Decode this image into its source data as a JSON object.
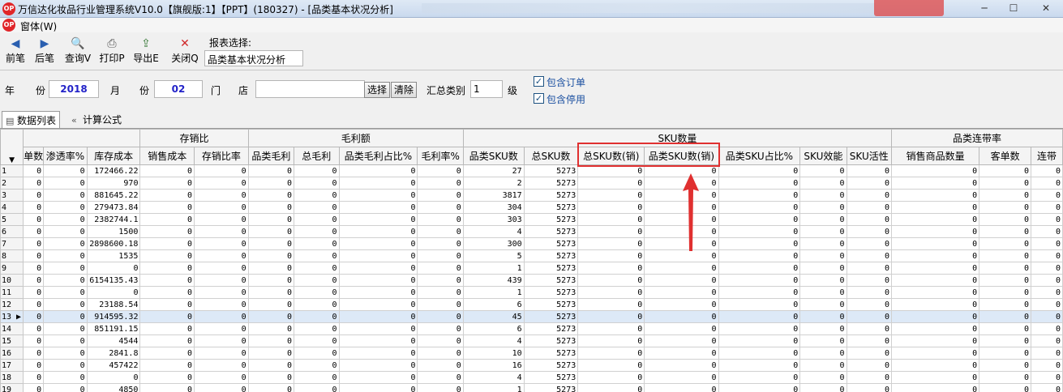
{
  "window": {
    "title": "万信达化妆品行业管理系统V10.0【旗舰版:1】【PPT】(180327) - [品类基本状况分析]",
    "app_icon_text": "OP",
    "controls": {
      "minimize": "─",
      "maximize": "☐",
      "close": "✕"
    }
  },
  "menu": {
    "window_label": "窗体(W)"
  },
  "toolbar": {
    "prev": "前笔",
    "next": "后笔",
    "query": "查询V",
    "print": "打印P",
    "export": "导出E",
    "close": "关闭Q",
    "report_label": "报表选择:",
    "report_value": "品类基本状况分析"
  },
  "filters": {
    "year_label_1": "年",
    "year_label_2": "份",
    "year_value": "2018",
    "month_label_1": "月",
    "month_label_2": "份",
    "month_value": "02",
    "store_label_1": "门",
    "store_label_2": "店",
    "store_value": "",
    "select_btn": "选择",
    "clear_btn": "清除",
    "summary_label": "汇总类别",
    "summary_value": "1",
    "level_label": "级",
    "include_orders": "包含订单",
    "include_disabled": "包含停用"
  },
  "tabs": {
    "data_list": "数据列表",
    "formula": "计算公式"
  },
  "grid": {
    "groups": {
      "g1": "存销比",
      "g2": "毛利额",
      "g3": "SKU数量",
      "g4": "品类连带率"
    },
    "columns": [
      "单数",
      "渗透率%",
      "库存成本",
      "销售成本",
      "存销比率",
      "品类毛利",
      "总毛利",
      "品类毛利占比%",
      "毛利率%",
      "品类SKU数",
      "总SKU数",
      "总SKU数(销)",
      "品类SKU数(销)",
      "品类SKU占比%",
      "SKU效能",
      "SKU活性",
      "销售商品数量",
      "客单数",
      "连带"
    ],
    "rows": [
      {
        "n": "1",
        "inv": "172466.22",
        "sku": "27",
        "total": "5273"
      },
      {
        "n": "2",
        "inv": "970",
        "sku": "2",
        "total": "5273"
      },
      {
        "n": "3",
        "inv": "881645.22",
        "sku": "3817",
        "total": "5273"
      },
      {
        "n": "4",
        "inv": "279473.84",
        "sku": "304",
        "total": "5273"
      },
      {
        "n": "5",
        "inv": "2382744.1",
        "sku": "303",
        "total": "5273"
      },
      {
        "n": "6",
        "inv": "1500",
        "sku": "4",
        "total": "5273"
      },
      {
        "n": "7",
        "inv": "2898600.18",
        "sku": "300",
        "total": "5273"
      },
      {
        "n": "8",
        "inv": "1535",
        "sku": "5",
        "total": "5273"
      },
      {
        "n": "9",
        "inv": "0",
        "sku": "1",
        "total": "5273"
      },
      {
        "n": "10",
        "inv": "6154135.43",
        "sku": "439",
        "total": "5273"
      },
      {
        "n": "11",
        "inv": "0",
        "sku": "1",
        "total": "5273"
      },
      {
        "n": "12",
        "inv": "23188.54",
        "sku": "6",
        "total": "5273"
      },
      {
        "n": "13",
        "inv": "914595.32",
        "sku": "45",
        "total": "5273"
      },
      {
        "n": "14",
        "inv": "851191.15",
        "sku": "6",
        "total": "5273"
      },
      {
        "n": "15",
        "inv": "4544",
        "sku": "4",
        "total": "5273"
      },
      {
        "n": "16",
        "inv": "2841.8",
        "sku": "10",
        "total": "5273"
      },
      {
        "n": "17",
        "inv": "457422",
        "sku": "16",
        "total": "5273"
      },
      {
        "n": "18",
        "inv": "0",
        "sku": "4",
        "total": "5273"
      },
      {
        "n": "19",
        "inv": "4850",
        "sku": "1",
        "total": "5273"
      }
    ],
    "selected_row": "13",
    "zero": "0"
  },
  "colors": {
    "highlight_box": "#e03030",
    "selected_row": "#dde9f7"
  }
}
